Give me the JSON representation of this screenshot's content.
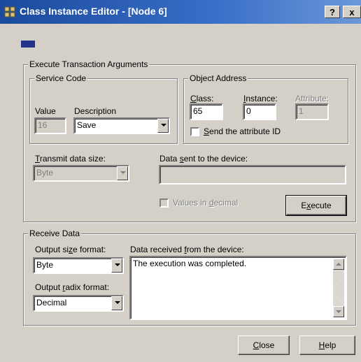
{
  "window": {
    "title": "Class Instance Editor - [Node 6]",
    "help_button": "?",
    "close_button": "x"
  },
  "execute_group": {
    "label": "Execute Transaction Arguments",
    "service_code": {
      "label": "Service Code",
      "value_label": "Value",
      "value": "16",
      "description_label": "Description",
      "description_selected": "Save"
    },
    "object_address": {
      "label": "Object Address",
      "class_label": "Class:",
      "class_value": "65",
      "instance_label": "Instance:",
      "instance_value": "0",
      "attribute_label": "Attribute:",
      "attribute_value": "1",
      "send_attribute_label": "Send the attribute ID"
    },
    "transmit_size_label": "Transmit data size:",
    "transmit_size_value": "Byte",
    "data_sent_label": "Data sent to the device:",
    "data_sent_value": "",
    "values_in_decimal_label": "Values in decimal",
    "execute_button": "Execute"
  },
  "receive_group": {
    "label": "Receive Data",
    "output_size_label": "Output size format:",
    "output_size_value": "Byte",
    "output_radix_label": "Output radix format:",
    "output_radix_value": "Decimal",
    "data_received_label": "Data received from the device:",
    "data_received_text": "The execution was completed."
  },
  "footer": {
    "close_button": "Close",
    "help_button": "Help"
  }
}
